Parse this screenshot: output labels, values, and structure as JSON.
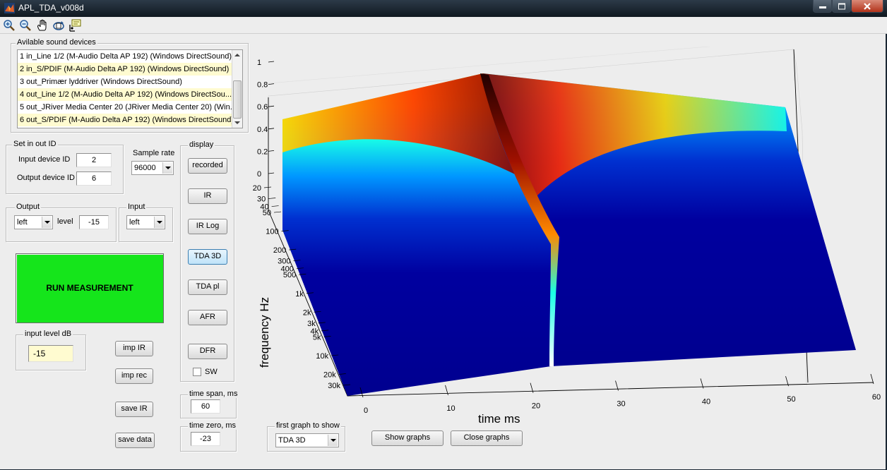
{
  "window": {
    "title": "APL_TDA_v008d"
  },
  "toolbar": {
    "icons": [
      "zoom-in-icon",
      "zoom-out-icon",
      "pan-hand-icon",
      "rotate-3d-icon",
      "data-cursor-icon"
    ]
  },
  "devices": {
    "title": "Avilable sound devices",
    "items": [
      {
        "label": "1 in_Line 1/2 (M-Audio Delta AP 192) (Windows DirectSound)",
        "selected": false
      },
      {
        "label": "2 in_S/PDIF (M-Audio Delta AP 192) (Windows DirectSound)",
        "selected": true
      },
      {
        "label": "3 out_Primær lyddriver (Windows DirectSound)",
        "selected": false
      },
      {
        "label": "4 out_Line 1/2 (M-Audio Delta AP 192) (Windows DirectSou...",
        "selected": true
      },
      {
        "label": "5 out_JRiver Media Center 20 (JRiver Media Center 20) (Win...",
        "selected": false
      },
      {
        "label": "6 out_S/PDIF (M-Audio Delta AP 192) (Windows DirectSound)",
        "selected": true
      }
    ]
  },
  "io_ids": {
    "title": "Set in out ID",
    "input_label": "Input device ID",
    "input_value": "2",
    "output_label": "Output device ID",
    "output_value": "6"
  },
  "sample_rate": {
    "label": "Sample rate",
    "value": "96000"
  },
  "output": {
    "title": "Output",
    "channel": "left",
    "level_label": "level",
    "level_value": "-15"
  },
  "input": {
    "title": "Input",
    "channel": "left"
  },
  "run_button": "RUN MEASUREMENT",
  "input_level": {
    "title": "input level dB",
    "value": "-15"
  },
  "file_buttons": {
    "imp_ir": "imp IR",
    "imp_rec": "imp rec",
    "save_ir": "save IR",
    "save_data": "save data"
  },
  "display": {
    "title": "display",
    "buttons": [
      "recorded",
      "IR",
      "IR Log",
      "TDA 3D",
      "TDA pl",
      "AFR",
      "DFR"
    ],
    "active": "TDA 3D",
    "sw_label": "SW"
  },
  "time_span": {
    "title": "time span, ms",
    "value": "60"
  },
  "time_zero": {
    "title": "time zero, ms",
    "value": "-23"
  },
  "first_graph": {
    "title": "first graph to show",
    "value": "TDA 3D"
  },
  "actions": {
    "show": "Show graphs",
    "close": "Close graphs"
  },
  "plot": {
    "z_ticks": [
      "0",
      "0.2",
      "0.4",
      "0.6",
      "0.8",
      "1"
    ],
    "freq_ticks": [
      "20",
      "30",
      "40",
      "50",
      "100",
      "200",
      "300",
      "400",
      "500",
      "1k",
      "2k",
      "3k",
      "4k",
      "5k",
      "10k",
      "20k",
      "30k"
    ],
    "time_ticks": [
      "0",
      "10",
      "20",
      "30",
      "40",
      "50",
      "60"
    ],
    "freq_label": "frequency   Hz",
    "time_label": "time   ms",
    "colors": {
      "peak": "#7f0000",
      "high": "#ff2a00",
      "mid_high": "#ffd400",
      "mid": "#19ffe6",
      "mid_low": "#0074ff",
      "low": "#00008f"
    }
  }
}
